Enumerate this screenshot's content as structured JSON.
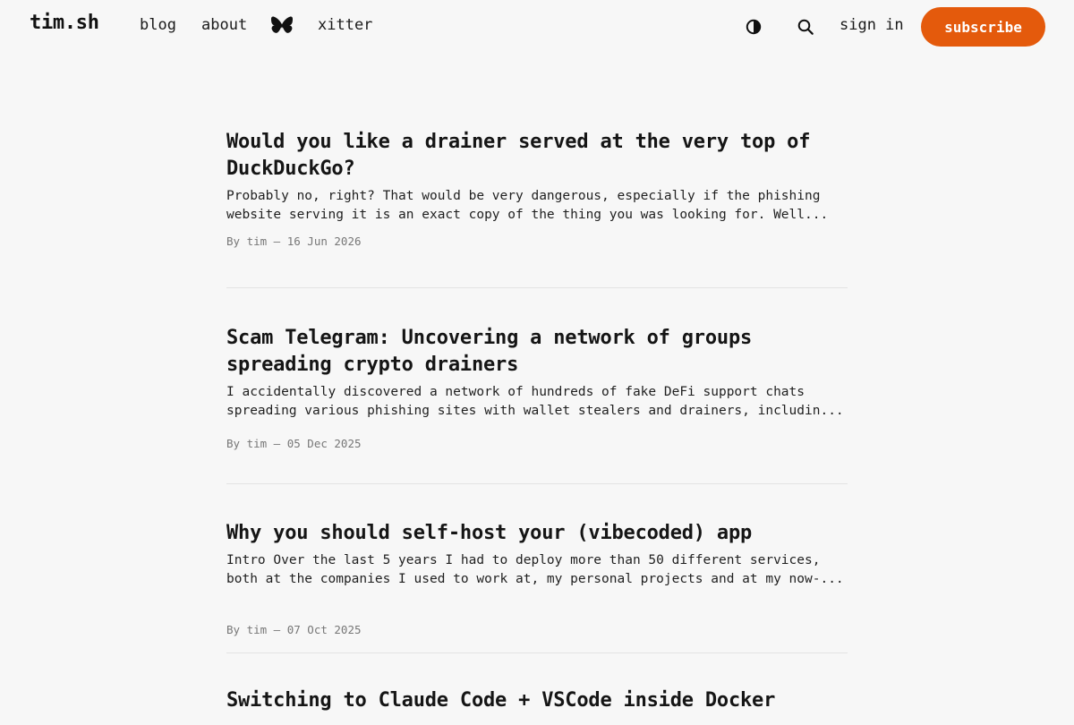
{
  "site": {
    "logo": "tim.sh"
  },
  "nav": {
    "blog": "blog",
    "about": "about",
    "xitter": "xitter",
    "sign_in": "sign in",
    "subscribe": "subscribe"
  },
  "icons": {
    "social": "butterfly-icon",
    "theme": "contrast-icon",
    "search": "search-icon"
  },
  "colors": {
    "background": "#f7f7f7",
    "accent": "#e45a0c",
    "text": "#151515",
    "muted": "#777777",
    "divider": "#e3e3e3"
  },
  "posts": [
    {
      "title": "Would you like a drainer served at the very top of DuckDuckGo?",
      "excerpt_line_1": "Probably no, right? That would be very dangerous, especially if the phishing",
      "excerpt_line_2": "website serving it is an exact copy of the thing you was looking for. Well...",
      "meta": "By tim — 16 Jun 2026"
    },
    {
      "title": "Scam Telegram: Uncovering a network of groups spreading crypto drainers",
      "excerpt_line_1": "I accidentally discovered a network of hundreds of fake DeFi support chats",
      "excerpt_line_2": "spreading various phishing sites with wallet stealers and drainers, includin...",
      "meta": "By tim — 05 Dec 2025"
    },
    {
      "title": "Why you should self-host your (vibecoded) app",
      "excerpt_line_1": "Intro Over the last 5 years I had to deploy more than 50 different services,",
      "excerpt_line_2": "both at the companies I used to work at, my personal projects and at my now-...",
      "meta": "By tim — 07 Oct 2025"
    },
    {
      "title": "Switching to Claude Code + VSCode inside Docker"
    }
  ]
}
